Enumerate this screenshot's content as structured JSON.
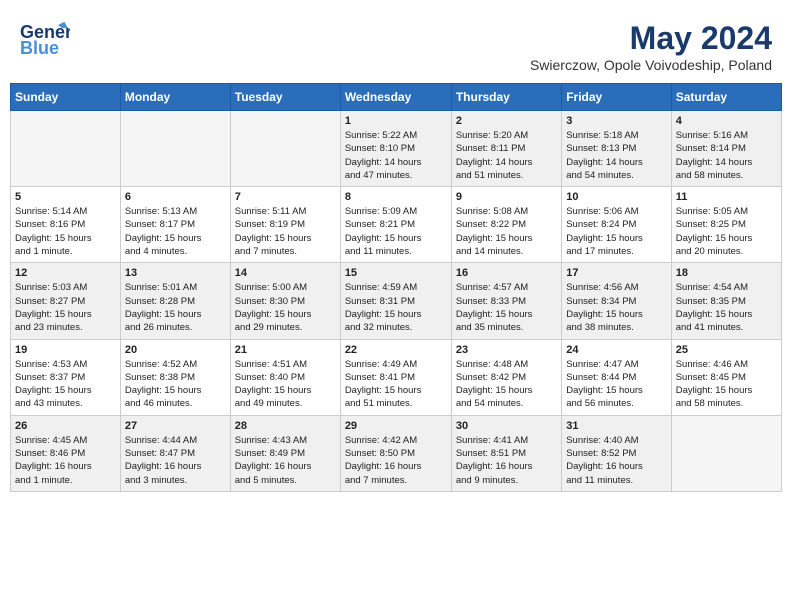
{
  "header": {
    "logo_line1": "General",
    "logo_line2": "Blue",
    "title": "May 2024",
    "subtitle": "Swierczow, Opole Voivodeship, Poland"
  },
  "days_of_week": [
    "Sunday",
    "Monday",
    "Tuesday",
    "Wednesday",
    "Thursday",
    "Friday",
    "Saturday"
  ],
  "weeks": [
    [
      {
        "day": "",
        "info": ""
      },
      {
        "day": "",
        "info": ""
      },
      {
        "day": "",
        "info": ""
      },
      {
        "day": "1",
        "info": "Sunrise: 5:22 AM\nSunset: 8:10 PM\nDaylight: 14 hours\nand 47 minutes."
      },
      {
        "day": "2",
        "info": "Sunrise: 5:20 AM\nSunset: 8:11 PM\nDaylight: 14 hours\nand 51 minutes."
      },
      {
        "day": "3",
        "info": "Sunrise: 5:18 AM\nSunset: 8:13 PM\nDaylight: 14 hours\nand 54 minutes."
      },
      {
        "day": "4",
        "info": "Sunrise: 5:16 AM\nSunset: 8:14 PM\nDaylight: 14 hours\nand 58 minutes."
      }
    ],
    [
      {
        "day": "5",
        "info": "Sunrise: 5:14 AM\nSunset: 8:16 PM\nDaylight: 15 hours\nand 1 minute."
      },
      {
        "day": "6",
        "info": "Sunrise: 5:13 AM\nSunset: 8:17 PM\nDaylight: 15 hours\nand 4 minutes."
      },
      {
        "day": "7",
        "info": "Sunrise: 5:11 AM\nSunset: 8:19 PM\nDaylight: 15 hours\nand 7 minutes."
      },
      {
        "day": "8",
        "info": "Sunrise: 5:09 AM\nSunset: 8:21 PM\nDaylight: 15 hours\nand 11 minutes."
      },
      {
        "day": "9",
        "info": "Sunrise: 5:08 AM\nSunset: 8:22 PM\nDaylight: 15 hours\nand 14 minutes."
      },
      {
        "day": "10",
        "info": "Sunrise: 5:06 AM\nSunset: 8:24 PM\nDaylight: 15 hours\nand 17 minutes."
      },
      {
        "day": "11",
        "info": "Sunrise: 5:05 AM\nSunset: 8:25 PM\nDaylight: 15 hours\nand 20 minutes."
      }
    ],
    [
      {
        "day": "12",
        "info": "Sunrise: 5:03 AM\nSunset: 8:27 PM\nDaylight: 15 hours\nand 23 minutes."
      },
      {
        "day": "13",
        "info": "Sunrise: 5:01 AM\nSunset: 8:28 PM\nDaylight: 15 hours\nand 26 minutes."
      },
      {
        "day": "14",
        "info": "Sunrise: 5:00 AM\nSunset: 8:30 PM\nDaylight: 15 hours\nand 29 minutes."
      },
      {
        "day": "15",
        "info": "Sunrise: 4:59 AM\nSunset: 8:31 PM\nDaylight: 15 hours\nand 32 minutes."
      },
      {
        "day": "16",
        "info": "Sunrise: 4:57 AM\nSunset: 8:33 PM\nDaylight: 15 hours\nand 35 minutes."
      },
      {
        "day": "17",
        "info": "Sunrise: 4:56 AM\nSunset: 8:34 PM\nDaylight: 15 hours\nand 38 minutes."
      },
      {
        "day": "18",
        "info": "Sunrise: 4:54 AM\nSunset: 8:35 PM\nDaylight: 15 hours\nand 41 minutes."
      }
    ],
    [
      {
        "day": "19",
        "info": "Sunrise: 4:53 AM\nSunset: 8:37 PM\nDaylight: 15 hours\nand 43 minutes."
      },
      {
        "day": "20",
        "info": "Sunrise: 4:52 AM\nSunset: 8:38 PM\nDaylight: 15 hours\nand 46 minutes."
      },
      {
        "day": "21",
        "info": "Sunrise: 4:51 AM\nSunset: 8:40 PM\nDaylight: 15 hours\nand 49 minutes."
      },
      {
        "day": "22",
        "info": "Sunrise: 4:49 AM\nSunset: 8:41 PM\nDaylight: 15 hours\nand 51 minutes."
      },
      {
        "day": "23",
        "info": "Sunrise: 4:48 AM\nSunset: 8:42 PM\nDaylight: 15 hours\nand 54 minutes."
      },
      {
        "day": "24",
        "info": "Sunrise: 4:47 AM\nSunset: 8:44 PM\nDaylight: 15 hours\nand 56 minutes."
      },
      {
        "day": "25",
        "info": "Sunrise: 4:46 AM\nSunset: 8:45 PM\nDaylight: 15 hours\nand 58 minutes."
      }
    ],
    [
      {
        "day": "26",
        "info": "Sunrise: 4:45 AM\nSunset: 8:46 PM\nDaylight: 16 hours\nand 1 minute."
      },
      {
        "day": "27",
        "info": "Sunrise: 4:44 AM\nSunset: 8:47 PM\nDaylight: 16 hours\nand 3 minutes."
      },
      {
        "day": "28",
        "info": "Sunrise: 4:43 AM\nSunset: 8:49 PM\nDaylight: 16 hours\nand 5 minutes."
      },
      {
        "day": "29",
        "info": "Sunrise: 4:42 AM\nSunset: 8:50 PM\nDaylight: 16 hours\nand 7 minutes."
      },
      {
        "day": "30",
        "info": "Sunrise: 4:41 AM\nSunset: 8:51 PM\nDaylight: 16 hours\nand 9 minutes."
      },
      {
        "day": "31",
        "info": "Sunrise: 4:40 AM\nSunset: 8:52 PM\nDaylight: 16 hours\nand 11 minutes."
      },
      {
        "day": "",
        "info": ""
      }
    ]
  ]
}
